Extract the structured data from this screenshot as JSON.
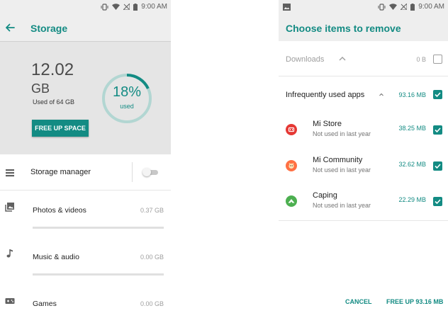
{
  "left": {
    "status": {
      "time": "9:00 AM"
    },
    "appbar": {
      "title": "Storage"
    },
    "summary": {
      "amount": "12.02",
      "unit": "GB",
      "used_of": "Used of 64 GB",
      "percent": "18%",
      "percent_caption": "used",
      "percent_value": 0.18,
      "free_up_label": "FREE UP SPACE"
    },
    "storage_manager": {
      "label": "Storage manager",
      "enabled": false
    },
    "categories": [
      {
        "label": "Photos & videos",
        "size": "0.37 GB",
        "icon": "photo-icon"
      },
      {
        "label": "Music & audio",
        "size": "0.00 GB",
        "icon": "music-note-icon"
      },
      {
        "label": "Games",
        "size": "0.00 GB",
        "icon": "gamepad-icon"
      }
    ]
  },
  "right": {
    "status": {
      "time": "9:00 AM"
    },
    "appbar": {
      "title": "Choose items to remove"
    },
    "downloads": {
      "label": "Downloads",
      "size": "0 B",
      "checked": false
    },
    "section": {
      "label": "Infrequently used apps",
      "size": "93.16 MB",
      "checked": true
    },
    "apps": [
      {
        "name": "Mi Store",
        "subtitle": "Not used in last year",
        "size": "38.25 MB",
        "checked": true,
        "icon": "mi-store-icon",
        "color": "#e53935"
      },
      {
        "name": "Mi Community",
        "subtitle": "Not used in last year",
        "size": "32.62 MB",
        "checked": true,
        "icon": "mi-community-icon",
        "color": "#ff7043"
      },
      {
        "name": "Caping",
        "subtitle": "Not used in last year",
        "size": "22.29 MB",
        "checked": true,
        "icon": "caping-icon",
        "color": "#4caf50"
      }
    ],
    "actions": {
      "cancel": "CANCEL",
      "free_up": "FREE UP 93.16 MB"
    }
  },
  "colors": {
    "accent": "#138b83",
    "appbar": "#eeeeee",
    "hero": "#e5e5e5"
  }
}
